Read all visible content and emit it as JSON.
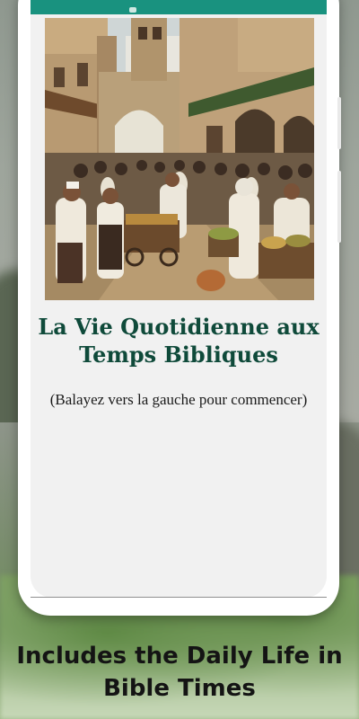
{
  "app": {
    "title": "La Vie Quotidienne aux Temps Bibliques",
    "hint": "(Balayez vers la gauche pour commencer)"
  },
  "promo": {
    "caption": "Includes the Daily Life in Bible Times"
  },
  "colors": {
    "appbar": "#19927f",
    "title": "#0f4a3a",
    "screen_bg": "#f1f1f1"
  },
  "icons": {
    "hero_image": "ancient-market-painting"
  }
}
